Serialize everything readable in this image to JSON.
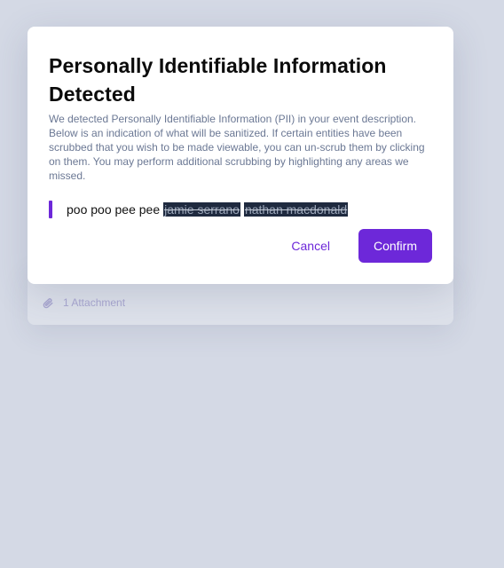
{
  "backdrop": {
    "attachment_label": "1 Attachment",
    "attachment_icon": "paperclip-icon"
  },
  "modal": {
    "title": "Personally Identifiable Information Detected",
    "description": "We detected Personally Identifiable Information (PII) in your event description. Below is an indication of what will be sanitized. If certain entities have been scrubbed that you wish to be made viewable, you can un-scrub them by clicking on them. You may perform additional scrubbing by highlighting any areas we missed.",
    "preview": {
      "plain_text": "poo poo pee pee",
      "scrubbed_entities": [
        "jamie serrano",
        "nathan macdonald"
      ]
    },
    "cancel_label": "Cancel",
    "confirm_label": "Confirm"
  },
  "colors": {
    "accent": "#6d28d9",
    "backdrop": "#d4d9e5",
    "scrub_bg": "#1f2a3f"
  }
}
